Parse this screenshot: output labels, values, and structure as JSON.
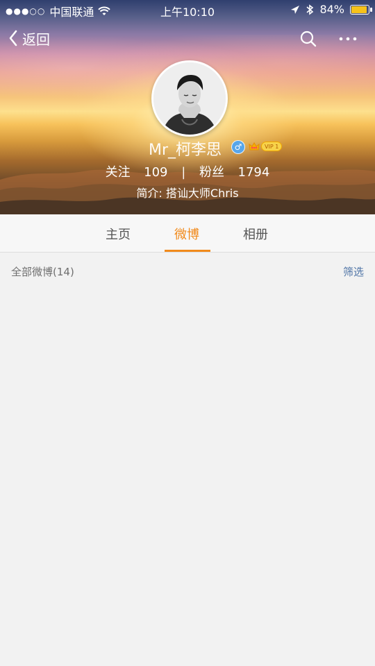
{
  "status_bar": {
    "carrier": "中国联通",
    "time": "上午10:10",
    "battery": "84%",
    "battery_level": 0.84
  },
  "nav": {
    "back_label": "返回",
    "icons": [
      "chevron-left-icon",
      "search-icon",
      "more-icon"
    ]
  },
  "profile": {
    "name": "Mr_柯李思",
    "vip_label": "VIP 1",
    "gender_symbol": "♂",
    "follow_label": "关注",
    "follow_count": "109",
    "fans_label": "粉丝",
    "fans_count": "1794",
    "intro": "简介: 搭讪大师Chris"
  },
  "tabs": [
    {
      "label": "主页"
    },
    {
      "label": "微博"
    },
    {
      "label": "相册"
    }
  ],
  "active_tab": "微博",
  "filter": {
    "summary": "全部微博(14)",
    "action": "筛选"
  },
  "colors": {
    "accent": "#f18a1b",
    "link": "#4f74a6",
    "background": "#f2f2f2"
  }
}
